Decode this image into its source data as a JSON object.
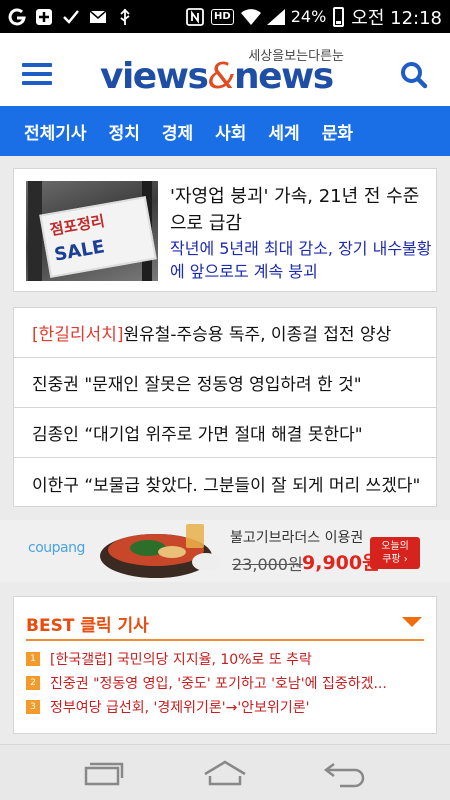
{
  "status": {
    "battery": "24%",
    "time": "오전 12:18",
    "hd_label": "HD"
  },
  "header": {
    "logo_tagline": "세상을보는다른눈",
    "logo_word1": "views",
    "logo_amp": "&",
    "logo_word2": "news"
  },
  "nav": {
    "items": [
      "전체기사",
      "정치",
      "경제",
      "사회",
      "세계",
      "문화"
    ]
  },
  "top_story": {
    "title": "'자영업 붕괴' 가속, 21년 전 수준으로 급감",
    "subtitle": "작년에 5년래 최대 감소, 장기 내수불황에 앞으로도 계속 붕괴",
    "thumb_sign_top": "점포정리",
    "thumb_sign_bottom": "SALE"
  },
  "headlines": {
    "items": [
      {
        "prefix": "[한길리서치]",
        "text": " 원유철-주승용 독주, 이종걸 접전 양상"
      },
      {
        "prefix": "",
        "text": "진중권 \"문재인 잘못은 정동영 영입하려 한 것\""
      },
      {
        "prefix": "",
        "text": "김종인 “대기업 위주로 가면 절대 해결 못한다\""
      },
      {
        "prefix": "",
        "text": "이한구 “보물급 찾았다. 그분들이 잘 되게 머리 쓰겠다\""
      }
    ]
  },
  "ad": {
    "brand": "coupang",
    "title": "불고기브라더스 이용권",
    "old_price": "23,000원",
    "new_price": "9,900원",
    "badge_line1": "오늘의",
    "badge_line2": "쿠팡 ›"
  },
  "best": {
    "heading": "BEST 클릭 기사",
    "items": [
      {
        "rank": "1",
        "text": "[한국갤럽] 국민의당 지지율, 10%로 또 추락"
      },
      {
        "rank": "2",
        "text": "진중권 \"정동영 영입, '중도' 포기하고 '호남'에 집중하겠..."
      },
      {
        "rank": "3",
        "text": "정부여당 급선회, '경제위기론'→'안보위기론'"
      }
    ]
  },
  "colors": {
    "nav_bg": "#1a6ee6",
    "logo_blue": "#1e4ea6",
    "accent_orange": "#e84c0e",
    "headline_prefix_red": "#e23a2e",
    "subtitle_blue": "#1d2bb0"
  }
}
